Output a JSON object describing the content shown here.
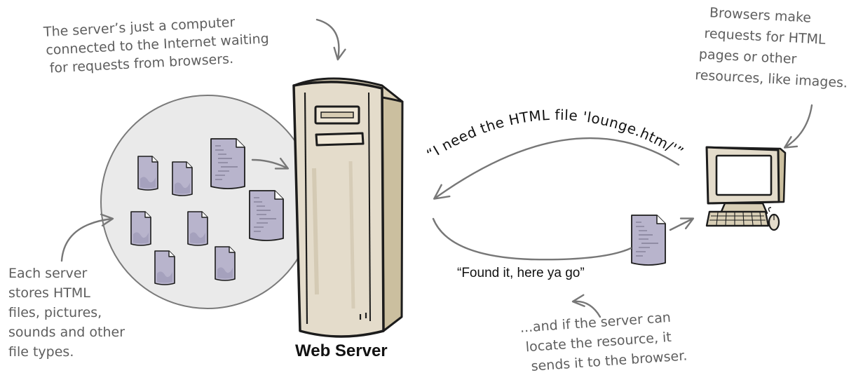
{
  "annotations": {
    "server_note": [
      "The server’s just a computer",
      "connected to the Internet waiting",
      "for requests from browsers."
    ],
    "browser_note": [
      "Browsers make",
      "requests for HTML",
      "pages or other",
      "resources, like images."
    ],
    "storage_note": [
      "Each server",
      "stores HTML",
      "files, pictures,",
      "sounds and other",
      "file types."
    ],
    "response_note": [
      "...and if the server can",
      "locate the resource, it",
      "sends it to the browser."
    ]
  },
  "request_quote": "“I need the HTML file 'lounge.htm/'”",
  "response_quote": "“Found it, here ya go”",
  "server_label": "Web Server",
  "colors": {
    "annotation_text": "#5e5e5e",
    "arrow": "#777777",
    "server_body": "#e4dccb",
    "storage_circle": "#eaeaea",
    "document": "#b8b4cc",
    "monitor_screen": "#ffffff"
  },
  "icons": [
    "document-icon",
    "web-server-tower",
    "desktop-computer",
    "keyboard-icon",
    "mouse-icon"
  ]
}
